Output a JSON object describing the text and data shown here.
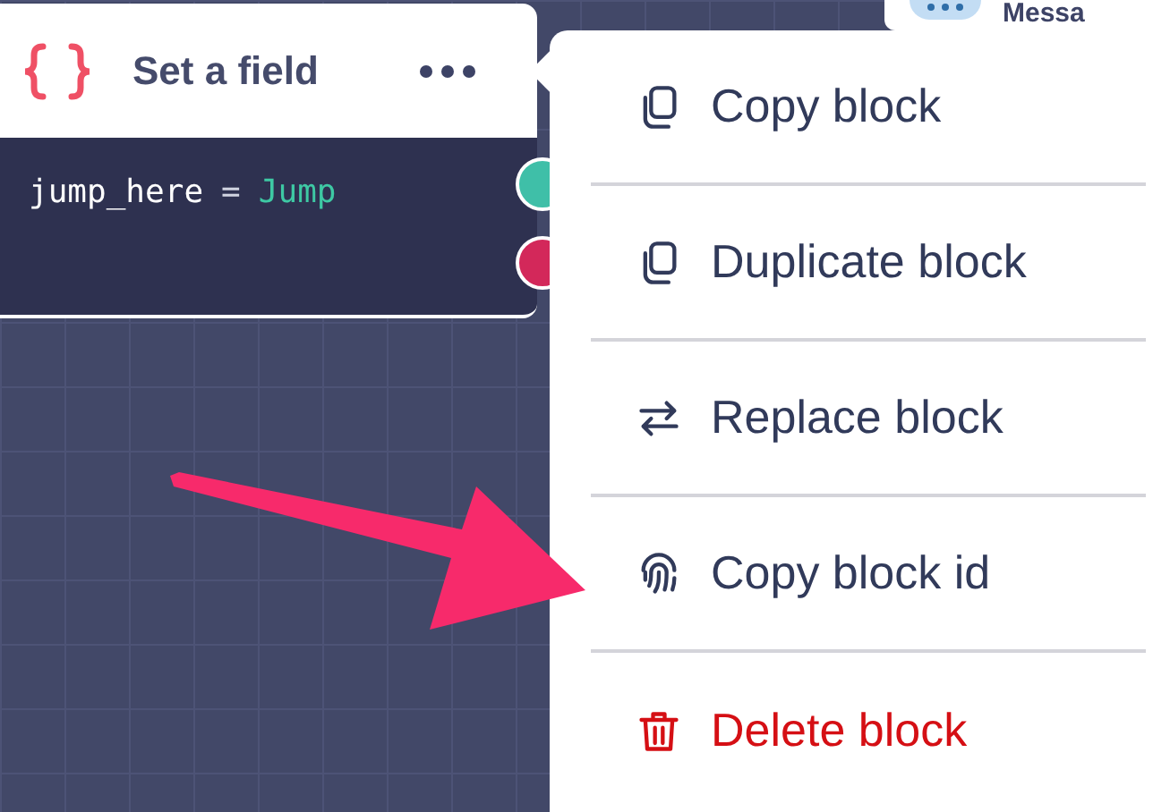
{
  "block": {
    "title": "Set a field",
    "code": {
      "variable": "jump_here",
      "operator": "=",
      "value": "Jump"
    }
  },
  "next_node": {
    "title": "Messa"
  },
  "menu": {
    "items": [
      {
        "label": "Copy block",
        "kind": "copy"
      },
      {
        "label": "Duplicate block",
        "kind": "duplicate"
      },
      {
        "label": "Replace block",
        "kind": "replace"
      },
      {
        "label": "Copy block id",
        "kind": "fingerprint"
      },
      {
        "label": "Delete block",
        "kind": "delete"
      }
    ]
  }
}
